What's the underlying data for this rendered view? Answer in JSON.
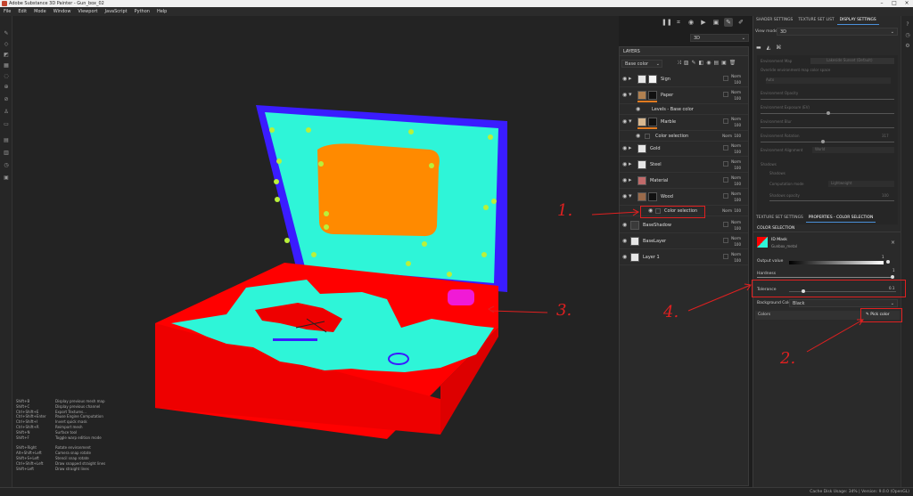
{
  "window": {
    "title": "Adobe Substance 3D Painter - Gun_box_02"
  },
  "menu": [
    "File",
    "Edit",
    "Mode",
    "Window",
    "Viewport",
    "JavaScript",
    "Python",
    "Help"
  ],
  "viewport": {
    "mode_select": "3D"
  },
  "right_tabs": [
    "SHADER SETTINGS",
    "TEXTURE SET LIST",
    "DISPLAY SETTINGS"
  ],
  "view_mode": {
    "label": "View mode",
    "value": "3D"
  },
  "layers_panel": {
    "title": "LAYERS",
    "channel": "Base color",
    "layers": [
      {
        "name": "Sign",
        "blend": "Norm",
        "opacity": "100"
      },
      {
        "name": "Paper",
        "blend": "Norm",
        "opacity": "100"
      },
      {
        "name": "Levels - Base color",
        "blend": "",
        "opacity": ""
      },
      {
        "name": "Marble",
        "blend": "Norm",
        "opacity": "100"
      },
      {
        "name": "Color selection",
        "blend": "Norm",
        "opacity": "100"
      },
      {
        "name": "Gold",
        "blend": "Norm",
        "opacity": "100"
      },
      {
        "name": "Steel",
        "blend": "Norm",
        "opacity": "100"
      },
      {
        "name": "Material",
        "blend": "Norm",
        "opacity": "100"
      },
      {
        "name": "Wood",
        "blend": "Norm",
        "opacity": "100"
      },
      {
        "name": "Color selection",
        "blend": "Norm",
        "opacity": "100"
      },
      {
        "name": "BaseShadow",
        "blend": "Norm",
        "opacity": "100"
      },
      {
        "name": "BaseLayer",
        "blend": "Norm",
        "opacity": "100"
      },
      {
        "name": "Layer 1",
        "blend": "Norm",
        "opacity": "100"
      }
    ]
  },
  "display_settings": {
    "env_map": "Environment Map",
    "env_map_value": "Lakeside Sunset (Default)",
    "override": "Override environment map color space",
    "auto": "Auto",
    "items": [
      "Environment Opacity",
      "Environment Exposure (EV)",
      "Environment Blur",
      "Environment Rotation",
      "Environment Alignment"
    ],
    "env_rotation_value": "317",
    "alignment_value": "World",
    "shadows_header": "Shadows",
    "shadows_check": "Shadows",
    "computation_mode": "Computation mode",
    "computation_value": "Lightweight",
    "shadows_opacity": "Shadows opacity",
    "opacity_value": "100"
  },
  "props_tabs": [
    "TEXTURE SET SETTINGS",
    "PROPERTIES - COLOR SELECTION"
  ],
  "color_selection": {
    "header": "COLOR SELECTION",
    "mesh_name": "ID Mask",
    "mesh_sub": "Gunbox_metal",
    "output_value": "Output value",
    "output_num": "1",
    "hardness": "Hardness",
    "hardness_num": "1",
    "tolerance": "Tolerance",
    "tolerance_num": "0.1",
    "bg_color_label": "Background Color",
    "bg_color_value": "Black",
    "colors_label": "Colors",
    "pick_color": "Pick color"
  },
  "shortcuts": [
    [
      "Shift+B",
      "Display previous mesh map"
    ],
    [
      "Shift+C",
      "Display previous channel"
    ],
    [
      "Ctrl+Shift+E",
      "Export Textures..."
    ],
    [
      "Ctrl+Shift+Enter",
      "Pause Engine Computation"
    ],
    [
      "Ctrl+Shift+I",
      "Invert quick mask"
    ],
    [
      "Ctrl+Shift+R",
      "Reimport mesh"
    ],
    [
      "Shift+N",
      "Surface tool"
    ],
    [
      "Shift+F",
      "Toggle warp edition mode"
    ],
    [
      "",
      ""
    ],
    [
      "Shift+Right",
      "Rotate environment"
    ],
    [
      "Alt+Shift+Left",
      "Camera snap rotate"
    ],
    [
      "Shift+S+Left",
      "Stencil snap rotate"
    ],
    [
      "Ctrl+Shift+Left",
      "Draw snapped straight lines"
    ],
    [
      "Shift+Left",
      "Draw straight lines"
    ]
  ],
  "status": {
    "text": "Cache Disk Usage:  34% | Version: 9.0.0 (OpenGL)"
  },
  "annotations": [
    "1.",
    "2.",
    "3.",
    "4."
  ],
  "colors": {
    "cyan": "#2ef5d8",
    "red": "#ff0000",
    "blue": "#3a1cff",
    "orange": "#ff8a00",
    "magenta": "#f01ad6",
    "annot_red": "#e02020"
  }
}
